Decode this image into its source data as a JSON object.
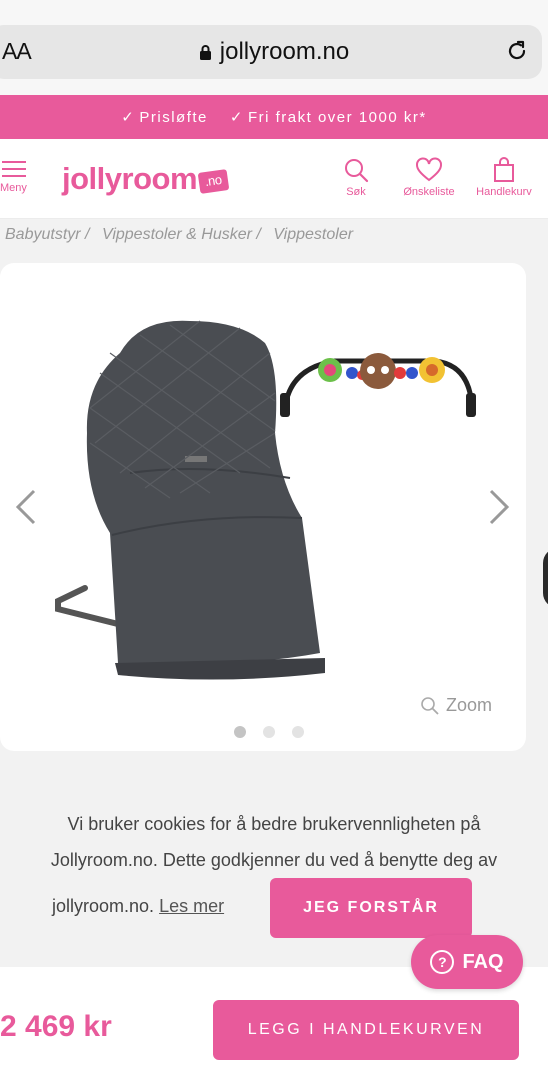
{
  "browser": {
    "aa_label": "AA",
    "url": "jollyroom.no"
  },
  "promo": {
    "item1": "Prisløfte",
    "item2": "Fri frakt over 1000 kr*"
  },
  "header": {
    "menu_label": "Meny",
    "logo_text": "jollyroom",
    "logo_badge": ".no",
    "search_label": "Søk",
    "wishlist_label": "Ønskeliste",
    "cart_label": "Handlekurv"
  },
  "breadcrumb": [
    "Babyutstyr /",
    "Vippestoler & Husker /",
    "Vippestoler"
  ],
  "gallery": {
    "zoom_label": "Zoom",
    "dots": 3,
    "active_dot": 0
  },
  "cookie": {
    "line1": "Vi bruker cookies for å bedre brukervennligheten på",
    "line2": "Jollyroom.no. Dette godkjenner du ved å benytte deg av",
    "line3": "jollyroom.no.",
    "read_more": "Les mer",
    "accept": "JEG FORSTÅR"
  },
  "faq_label": "FAQ",
  "product": {
    "price": "2 469 kr",
    "add_to_cart": "LEGG I HANDLEKURVEN"
  },
  "colors": {
    "brand": "#e85a9b",
    "chair": "#4a4d52"
  }
}
